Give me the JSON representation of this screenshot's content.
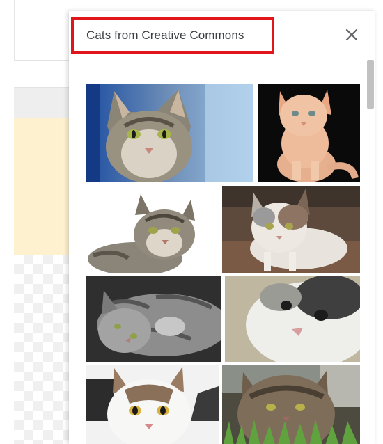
{
  "panel": {
    "title": "Cats from Creative Commons"
  },
  "photos": [
    {
      "subject": "tabby cat with green eyes",
      "bg": "#3a78c2"
    },
    {
      "subject": "orange kitten on black",
      "bg": "#0b0b0b"
    },
    {
      "subject": "tabby cat lying on white",
      "bg": "#ffffff"
    },
    {
      "subject": "calico cat on wood",
      "bg": "#6b5a4d"
    },
    {
      "subject": "grey tabby cat lying down",
      "bg": "#3a3a3a"
    },
    {
      "subject": "close-up white grey cat",
      "bg": "#c9c0ac"
    },
    {
      "subject": "white tabby cat with yellow eyes",
      "bg": "#f4f4f4"
    },
    {
      "subject": "long haired tabby in grass",
      "bg": "#6e7a60"
    }
  ],
  "icons": {
    "close": "close-icon"
  }
}
